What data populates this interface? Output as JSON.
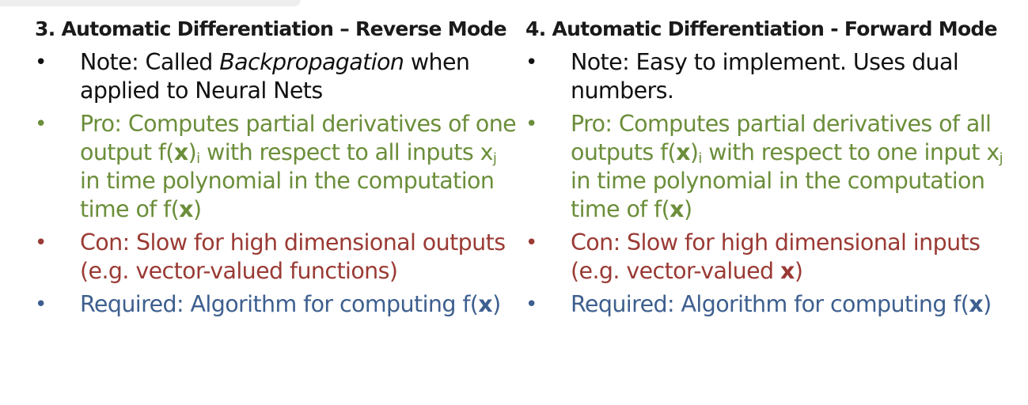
{
  "left": {
    "heading": "3. Automatic Differentiation – Reverse Mode",
    "bullet_char": "•",
    "note": {
      "label": "Note: Called ",
      "em": "Backpropagation",
      "rest": " when applied to Neural Nets"
    },
    "pro": {
      "p1": "Pro: Computes partial derivatives of one output f(",
      "x1": "x",
      "p2": ")",
      "sub_i": "i",
      "p3": " with respect to all inputs x",
      "sub_j": "j",
      "p4": " in time polynomial in the computation time of f(",
      "x2": "x",
      "p5": ")"
    },
    "con": {
      "text": "Con: Slow for high dimensional outputs (e.g. vector-valued functions)"
    },
    "req": {
      "p1": "Required: Algorithm for computing f(",
      "x": "x",
      "p2": ")"
    }
  },
  "right": {
    "heading": "4. Automatic Differentiation - Forward Mode",
    "bullet_char": "•",
    "note": {
      "text": "Note: Easy to implement. Uses dual numbers."
    },
    "pro": {
      "p1": "Pro: Computes partial derivatives of all outputs f(",
      "x1": "x",
      "p2": ")",
      "sub_i": "i",
      "p3": " with respect to one input x",
      "sub_j": "j",
      "p4": " in time polynomial in the computation time of f(",
      "x2": "x",
      "p5": ")"
    },
    "con": {
      "p1": "Con: Slow for high dimensional inputs (e.g. vector-valued ",
      "x": "x",
      "p2": ")"
    },
    "req": {
      "p1": "Required: Algorithm for computing f(",
      "x": "x",
      "p2": ")"
    }
  },
  "colors": {
    "note": "#111111",
    "pro": "#6b8e3a",
    "con": "#9a3a34",
    "req": "#3d5f8f"
  }
}
